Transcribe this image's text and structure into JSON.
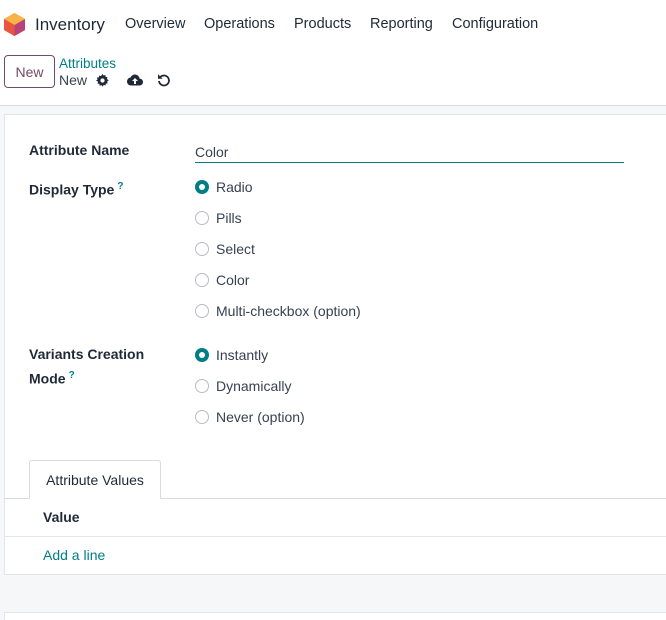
{
  "app": {
    "name": "Inventory",
    "logo_icon": "inventory-app-icon"
  },
  "menu": {
    "items": [
      {
        "label": "Overview"
      },
      {
        "label": "Operations"
      },
      {
        "label": "Products"
      },
      {
        "label": "Reporting"
      },
      {
        "label": "Configuration"
      }
    ]
  },
  "control_panel": {
    "new_label": "New",
    "breadcrumb_parent": "Attributes",
    "breadcrumb_current": "New",
    "icons": [
      "gear-icon",
      "cloud-upload-icon",
      "undo-icon"
    ]
  },
  "form": {
    "attribute_name_label": "Attribute Name",
    "attribute_name_value": "Color",
    "display_type_label": "Display Type",
    "help_mark": "?",
    "display_type_options": [
      {
        "label": "Radio",
        "checked": true
      },
      {
        "label": "Pills",
        "checked": false
      },
      {
        "label": "Select",
        "checked": false
      },
      {
        "label": "Color",
        "checked": false
      },
      {
        "label": "Multi-checkbox (option)",
        "checked": false
      }
    ],
    "variants_label_line1": "Variants Creation",
    "variants_label_line2": "Mode",
    "variants_options": [
      {
        "label": "Instantly",
        "checked": true
      },
      {
        "label": "Dynamically",
        "checked": false
      },
      {
        "label": "Never (option)",
        "checked": false
      }
    ]
  },
  "notebook": {
    "tab_label": "Attribute Values",
    "column_header": "Value",
    "add_line_label": "Add a line"
  },
  "colors": {
    "accent_teal": "#017e84",
    "brand_purple": "#714b67"
  }
}
